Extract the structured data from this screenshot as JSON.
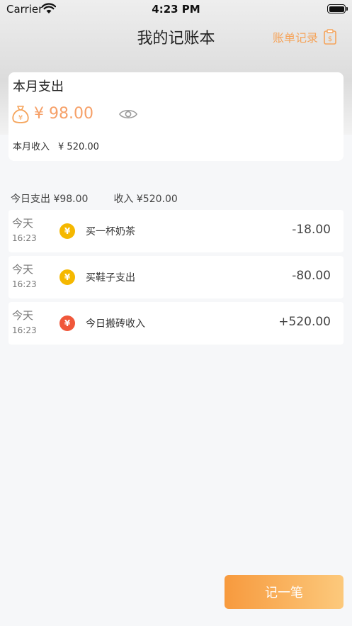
{
  "status_bar": {
    "carrier": "Carrier",
    "time": "4:23 PM"
  },
  "nav": {
    "title": "我的记账本",
    "records_label": "账单记录",
    "records_icon": "bill-document-icon"
  },
  "summary": {
    "title": "本月支出",
    "expense_amount": "¥ 98.00",
    "income_label": "本月收入",
    "income_amount": "¥ 520.00",
    "visibility_icon": "eye-icon"
  },
  "day_summary": {
    "expense": "今日支出 ¥98.00",
    "income": "收入 ¥520.00"
  },
  "records": [
    {
      "day": "今天",
      "time": "16:23",
      "type": "expense",
      "icon": "¥",
      "name": "买一杯奶茶",
      "amount": "-18.00"
    },
    {
      "day": "今天",
      "time": "16:23",
      "type": "expense",
      "icon": "¥",
      "name": "买鞋子支出",
      "amount": "-80.00"
    },
    {
      "day": "今天",
      "time": "16:23",
      "type": "income",
      "icon": "¥",
      "name": "今日搬砖收入",
      "amount": "+520.00"
    }
  ],
  "add_button": {
    "label": "记一笔"
  },
  "colors": {
    "accent": "#f5a45b",
    "expense_icon": "#f5b800",
    "income_icon": "#f0573a",
    "amount_highlight": "#f6a068"
  }
}
